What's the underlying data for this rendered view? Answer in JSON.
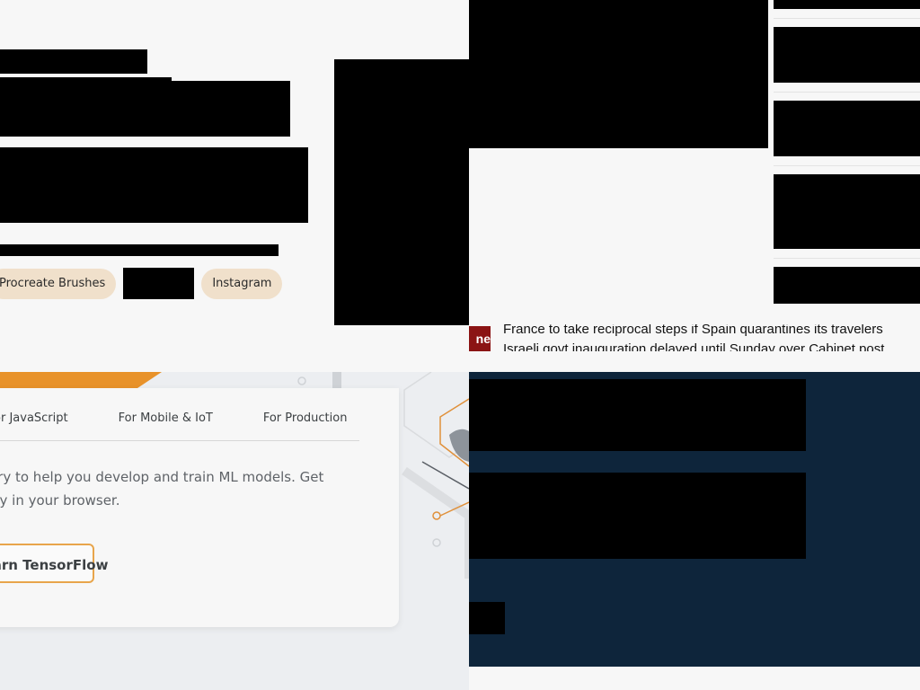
{
  "top_left": {
    "tags": [
      "Procreate Brushes",
      "Instagram"
    ]
  },
  "top_right": {
    "ticker": {
      "badge": "ne",
      "lines": [
        "France to take reciprocal steps if Spain quarantines its travelers",
        "Israeli govt inauguration delayed until Sunday over Cabinet post"
      ]
    }
  },
  "bottom_left": {
    "tabs": [
      "For JavaScript",
      "For Mobile & IoT",
      "For Production"
    ],
    "description": "An end-to-end open source machine learning library to help you develop and train ML models. Get started quickly by running Colab notebooks directly in your browser.",
    "button_label": "Learn TensorFlow"
  },
  "colors": {
    "tf_orange": "#e8922a",
    "tag_bg": "#f0e0cb",
    "navy": "#0e253b",
    "ticker_badge": "#8b1414"
  }
}
